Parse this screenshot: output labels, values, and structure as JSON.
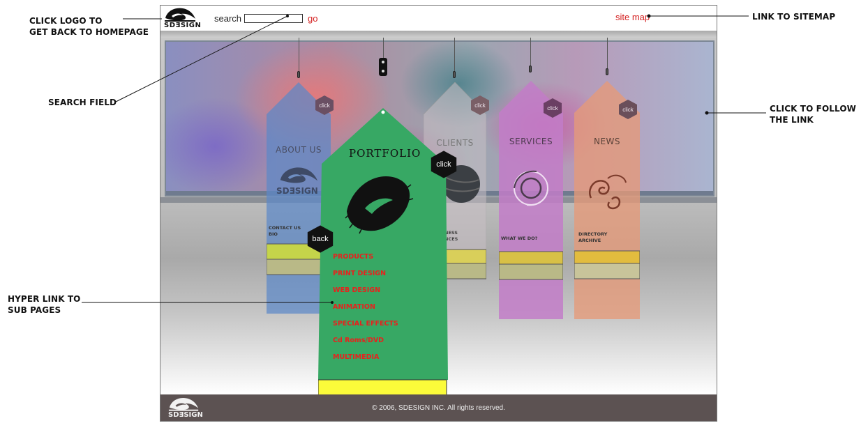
{
  "header": {
    "logo_text": "SDƎSIGN",
    "search_label": "search",
    "search_value": "",
    "go_label": "go",
    "site_map_label": "site map"
  },
  "annotations": {
    "logo_line1": "CLICK LOGO TO",
    "logo_line2": "GET BACK TO HOMEPAGE",
    "search": "SEARCH FIELD",
    "hyper_line1": "HYPER LINK TO",
    "hyper_line2": "SUB PAGES",
    "sitemap": "LINK TO SITEMAP",
    "follow_line1": "CLICK TO FOLLOW",
    "follow_line2": "THE LINK"
  },
  "tags": {
    "about": {
      "title": "ABOUT US",
      "logo_text": "SDƎSIGN",
      "items": [
        "CONTACT US",
        "BIO"
      ],
      "click_label": "click",
      "color": "#5b88c8"
    },
    "clients": {
      "title": "CLIENTS",
      "items_fragment": [
        "NESS",
        "NCES"
      ],
      "click_label": "click"
    },
    "services": {
      "title": "SERVICES",
      "items": [
        "WHAT WE DO?"
      ],
      "click_label": "click",
      "color": "#c27cc8"
    },
    "news": {
      "title": "NEWS",
      "items": [
        "DIRECTORY",
        "ARCHIVE"
      ],
      "click_label": "click",
      "color": "#e59a78"
    }
  },
  "portfolio": {
    "title": "PORTFOLIO",
    "click_label": "click",
    "back_label": "back",
    "links": [
      "PRODUCTS",
      "PRINT DESIGN",
      "WEB DESIGN",
      "ANIMATION",
      "SPECIAL EFFECTS",
      "Cd Roms/DVD",
      "MULTIMEDIA"
    ],
    "color": "#37a864",
    "link_color": "#e8211d"
  },
  "footer": {
    "logo_text": "SDƎSIGN",
    "copyright": "© 2006, SDESIGN INC. All rights reserved."
  }
}
